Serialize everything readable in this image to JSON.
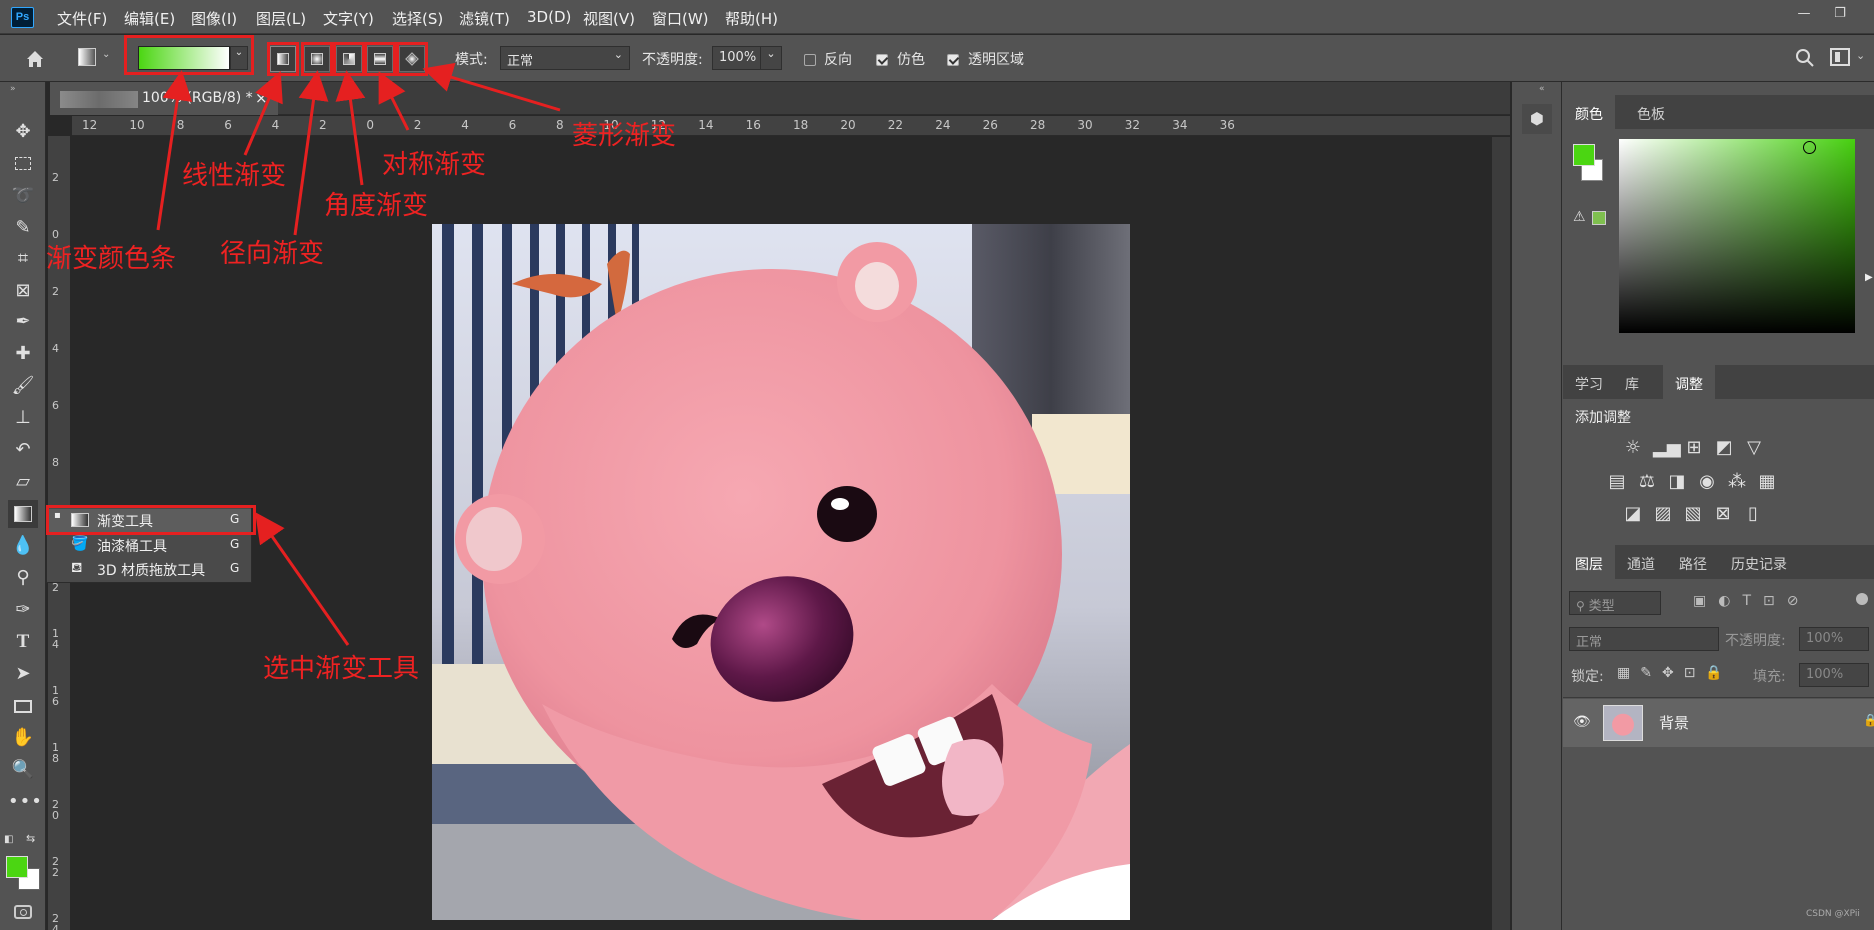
{
  "app": {
    "logo": "Ps"
  },
  "menu": [
    "文件(F)",
    "编辑(E)",
    "图像(I)",
    "图层(L)",
    "文字(Y)",
    "选择(S)",
    "滤镜(T)",
    "3D(D)",
    "视图(V)",
    "窗口(W)",
    "帮助(H)"
  ],
  "window_controls": {
    "minimize": "—",
    "restore": "❐"
  },
  "options": {
    "mode_label": "模式:",
    "mode_value": "正常",
    "opacity_label": "不透明度:",
    "opacity_value": "100%",
    "reverse_label": "反向",
    "dither_label": "仿色",
    "transparency_label": "透明区域",
    "reverse_checked": false,
    "dither_checked": true,
    "transparency_checked": true,
    "gradient_colors": [
      "#4bd612",
      "#ffffff"
    ]
  },
  "document": {
    "tab_title": "100%  (RGB/8) *",
    "close": "×"
  },
  "ruler_h": [
    "12",
    "10",
    "8",
    "6",
    "4",
    "2",
    "0",
    "2",
    "4",
    "6",
    "8",
    "10",
    "12",
    "14",
    "16",
    "18",
    "20",
    "22",
    "24",
    "26",
    "28",
    "30",
    "32",
    "34",
    "36"
  ],
  "ruler_v": [
    "2",
    "0",
    "2",
    "4",
    "6",
    "8",
    "10",
    "12",
    "14",
    "16",
    "18",
    "20",
    "22",
    "24"
  ],
  "flyout": {
    "items": [
      {
        "label": "渐变工具",
        "key": "G",
        "active": true
      },
      {
        "label": "油漆桶工具",
        "key": "G",
        "active": false
      },
      {
        "label": "3D 材质拖放工具",
        "key": "G",
        "active": false
      }
    ]
  },
  "panels": {
    "color_tabs": [
      "颜色",
      "色板"
    ],
    "learn_tabs": [
      "学习",
      "库",
      "调整"
    ],
    "add_adjustment": "添加调整",
    "layer_tabs": [
      "图层",
      "通道",
      "路径",
      "历史记录"
    ],
    "layer_search": "类型",
    "blend_mode": "正常",
    "opacity_label": "不透明度:",
    "opacity_value": "100%",
    "lock_label": "锁定:",
    "fill_label": "填充:",
    "fill_value": "100%",
    "layer_name": "背景",
    "foreground_color": "#4bd612",
    "background_color": "#ffffff"
  },
  "annotations": {
    "gradient_bar": "渐变颜色条",
    "linear": "线性渐变",
    "radial": "径向渐变",
    "angle": "角度渐变",
    "reflected": "对称渐变",
    "diamond": "菱形渐变",
    "select_tool": "选中渐变工具"
  },
  "watermark": "CSDN @XPii"
}
